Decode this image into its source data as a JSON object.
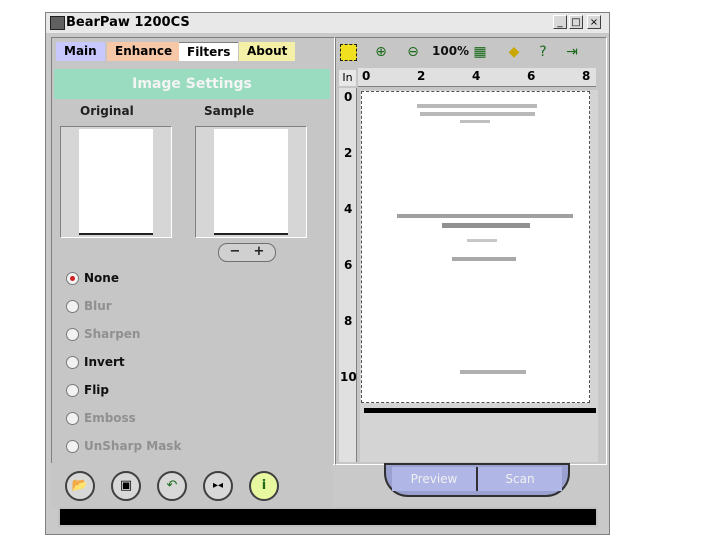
{
  "window": {
    "title": "BearPaw 1200CS",
    "min": "_",
    "max": "□",
    "close": "×"
  },
  "tabs": [
    {
      "label": "Main"
    },
    {
      "label": "Enhance"
    },
    {
      "label": "Filters"
    },
    {
      "label": "About"
    }
  ],
  "active_tab": "Filters",
  "left": {
    "header": "Image Settings",
    "original_label": "Original",
    "sample_label": "Sample",
    "zoom_minus": "−",
    "zoom_plus": "+",
    "filters": [
      {
        "label": "None",
        "selected": true,
        "enabled": true
      },
      {
        "label": "Blur",
        "selected": false,
        "enabled": false
      },
      {
        "label": "Sharpen",
        "selected": false,
        "enabled": false
      },
      {
        "label": "Invert",
        "selected": false,
        "enabled": true
      },
      {
        "label": "Flip",
        "selected": false,
        "enabled": true
      },
      {
        "label": "Emboss",
        "selected": false,
        "enabled": false
      },
      {
        "label": "UnSharp Mask",
        "selected": false,
        "enabled": false
      }
    ]
  },
  "toolbar": {
    "zoom_level": "100%"
  },
  "ruler": {
    "unit": "In",
    "h_ticks": [
      "0",
      "2",
      "4",
      "6",
      "8"
    ],
    "v_ticks": [
      "0",
      "2",
      "4",
      "6",
      "8",
      "10"
    ]
  },
  "actions": {
    "preview": "Preview",
    "scan": "Scan"
  },
  "colors": {
    "header_bg": "#99dcc0",
    "panel": "#c6c6c6",
    "radio_selected": "#d02020"
  }
}
